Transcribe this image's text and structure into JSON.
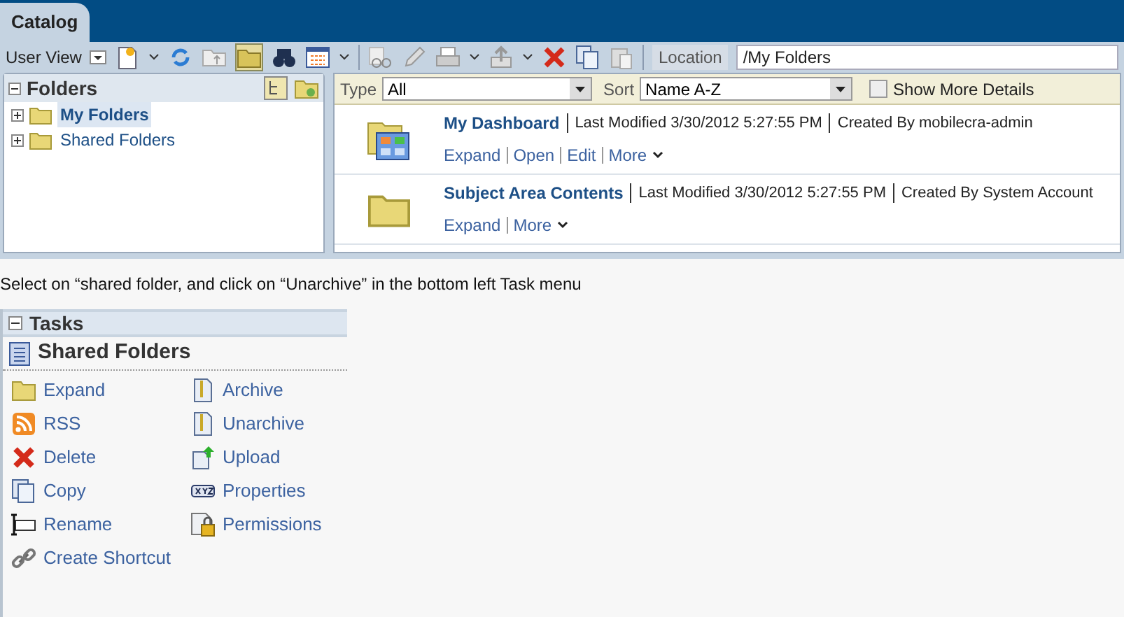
{
  "tab": {
    "label": "Catalog",
    "selected": true
  },
  "toolbar": {
    "view_label": "User View",
    "location_label": "Location",
    "location_value": "/My Folders"
  },
  "folders_panel": {
    "title": "Folders",
    "items": [
      {
        "label": "My Folders",
        "selected": true
      },
      {
        "label": "Shared Folders",
        "selected": false
      }
    ]
  },
  "filter": {
    "type_label": "Type",
    "type_value": "All",
    "sort_label": "Sort",
    "sort_value": "Name A-Z",
    "show_more": {
      "label": "Show More Details",
      "checked": false
    }
  },
  "items": [
    {
      "kind": "dashboard",
      "name": "My Dashboard",
      "modified": "Last Modified 3/30/2012 5:27:55 PM",
      "created": "Created By mobilecra-admin",
      "actions": [
        "Expand",
        "Open",
        "Edit"
      ],
      "more": "More"
    },
    {
      "kind": "folder",
      "name": "Subject Area Contents",
      "modified": "Last Modified 3/30/2012 5:27:55 PM",
      "created": "Created By System Account",
      "actions": [
        "Expand"
      ],
      "more": "More"
    }
  ],
  "instruction": "Select on “shared folder, and click on “Unarchive” in the bottom left Task menu",
  "tasks": {
    "title": "Tasks",
    "subtitle": "Shared Folders",
    "items": [
      {
        "kind": "expand",
        "label": "Expand"
      },
      {
        "kind": "archive",
        "label": "Archive"
      },
      {
        "kind": "rss",
        "label": "RSS"
      },
      {
        "kind": "archive",
        "label": "Unarchive"
      },
      {
        "kind": "delete",
        "label": "Delete"
      },
      {
        "kind": "upload",
        "label": "Upload"
      },
      {
        "kind": "copy",
        "label": "Copy"
      },
      {
        "kind": "properties",
        "label": "Properties"
      },
      {
        "kind": "rename",
        "label": "Rename"
      },
      {
        "kind": "permissions",
        "label": "Permissions"
      },
      {
        "kind": "shortcut",
        "label": "Create Shortcut"
      }
    ]
  }
}
